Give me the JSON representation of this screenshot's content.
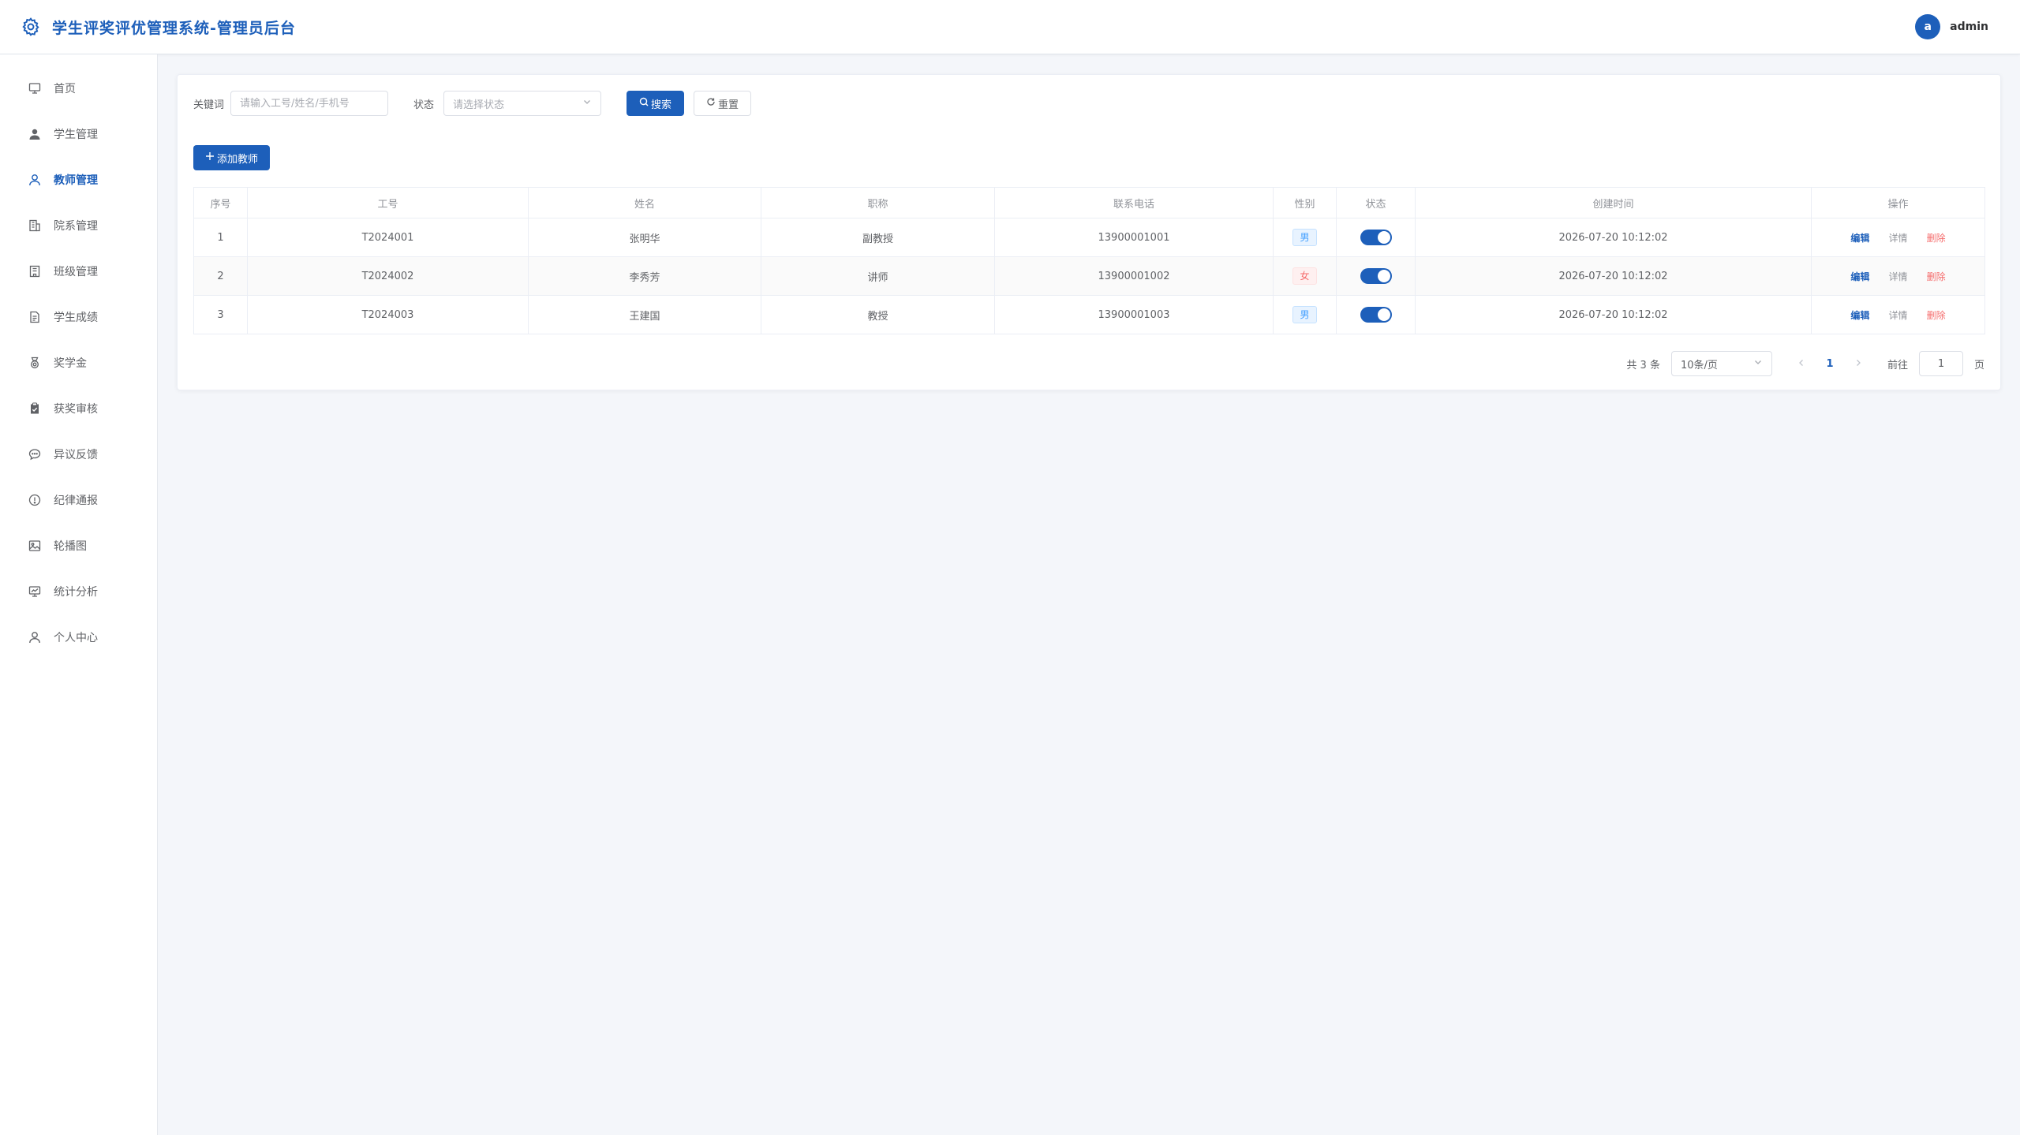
{
  "header": {
    "title": "学生评奖评优管理系统-管理员后台",
    "avatar_letter": "a",
    "username": "admin"
  },
  "sidebar": {
    "items": [
      {
        "label": "首页",
        "icon": "monitor-icon",
        "active": false
      },
      {
        "label": "学生管理",
        "icon": "user-filled-icon",
        "active": false
      },
      {
        "label": "教师管理",
        "icon": "user-icon",
        "active": true
      },
      {
        "label": "院系管理",
        "icon": "building-icon",
        "active": false
      },
      {
        "label": "班级管理",
        "icon": "office-icon",
        "active": false
      },
      {
        "label": "学生成绩",
        "icon": "document-icon",
        "active": false
      },
      {
        "label": "奖学金",
        "icon": "medal-icon",
        "active": false
      },
      {
        "label": "获奖审核",
        "icon": "checklist-icon",
        "active": false
      },
      {
        "label": "异议反馈",
        "icon": "chat-icon",
        "active": false
      },
      {
        "label": "纪律通报",
        "icon": "warning-icon",
        "active": false
      },
      {
        "label": "轮播图",
        "icon": "picture-icon",
        "active": false
      },
      {
        "label": "统计分析",
        "icon": "chart-icon",
        "active": false
      },
      {
        "label": "个人中心",
        "icon": "user-icon",
        "active": false
      }
    ]
  },
  "filters": {
    "keyword_label": "关键词",
    "keyword_placeholder": "请输入工号/姓名/手机号",
    "status_label": "状态",
    "status_placeholder": "请选择状态",
    "search_label": "搜索",
    "reset_label": "重置"
  },
  "add_button_label": "添加教师",
  "table": {
    "columns": [
      "序号",
      "工号",
      "姓名",
      "职称",
      "联系电话",
      "性别",
      "状态",
      "创建时间",
      "操作"
    ],
    "rows": [
      {
        "index": "1",
        "id": "T2024001",
        "name": "张明华",
        "title": "副教授",
        "phone": "13900001001",
        "gender": "男",
        "enabled": true,
        "created": "2026-07-20 10:12:02"
      },
      {
        "index": "2",
        "id": "T2024002",
        "name": "李秀芳",
        "title": "讲师",
        "phone": "13900001002",
        "gender": "女",
        "enabled": true,
        "created": "2026-07-20 10:12:02"
      },
      {
        "index": "3",
        "id": "T2024003",
        "name": "王建国",
        "title": "教授",
        "phone": "13900001003",
        "gender": "男",
        "enabled": true,
        "created": "2026-07-20 10:12:02"
      }
    ],
    "actions": {
      "edit": "编辑",
      "detail": "详情",
      "delete": "删除"
    }
  },
  "pagination": {
    "total_text": "共 3 条",
    "page_size": "10条/页",
    "current_page": "1",
    "goto_label": "前往",
    "goto_value": "1",
    "page_suffix": "页"
  },
  "colors": {
    "primary": "#1d5fba",
    "danger": "#f56c6c"
  }
}
